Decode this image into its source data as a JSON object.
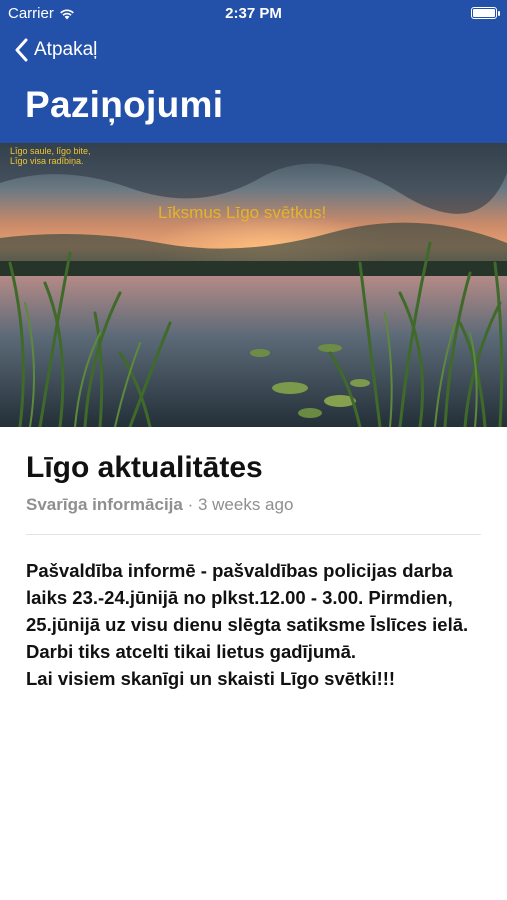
{
  "status_bar": {
    "carrier": "Carrier",
    "time": "2:37 PM"
  },
  "nav": {
    "back_label": "Atpakaļ",
    "title": "Paziņojumi"
  },
  "hero": {
    "caption_small_line1": "Līgo saule, līgo bite,",
    "caption_small_line2": "Līgo visa radībiņa.",
    "caption_main": "Līksmus Līgo svētkus!"
  },
  "post": {
    "title": "Līgo aktualitātes",
    "category": "Svarīga informācija",
    "separator": " · ",
    "time_ago": "3 weeks ago",
    "body": [
      "Pašvaldība informē - pašvaldības policijas darba laiks 23.-24.jūnijā no plkst.12.00 - 3.00. Pirmdien, 25.jūnijā uz visu dienu slēgta satiksme Īslīces ielā. Darbi tiks atcelti tikai lietus gadījumā.",
      "Lai visiem skanīgi un skaisti Līgo svētki!!!"
    ]
  },
  "colors": {
    "nav_bg": "#2350a8",
    "caption": "#e4b42a",
    "meta_gray": "#8f8f8f"
  }
}
